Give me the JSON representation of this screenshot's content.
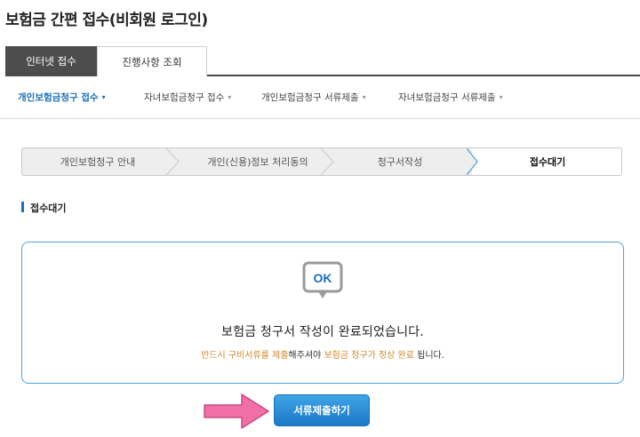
{
  "page": {
    "title": "보험금 간편 접수(비회원 로그인)"
  },
  "top_tabs": [
    {
      "label": "인터넷 접수",
      "active": true
    },
    {
      "label": "진행사항 조회",
      "active": false
    }
  ],
  "sub_nav": [
    {
      "label": "개인보험금청구 접수",
      "caret": "▾",
      "active": true
    },
    {
      "label": "자녀보험금청구 접수",
      "caret": "▾",
      "active": false
    },
    {
      "label": "개인보험금청구 서류제출",
      "caret": "▾",
      "active": false
    },
    {
      "label": "자녀보험금청구 서류제출",
      "caret": "▾",
      "active": false
    }
  ],
  "steps": [
    {
      "label": "개인보험청구 안내",
      "active": false
    },
    {
      "label": "개인(신용)정보 처리동의",
      "active": false
    },
    {
      "label": "청구서작성",
      "active": false
    },
    {
      "label": "접수대기",
      "active": true
    }
  ],
  "section": {
    "title": "접수대기"
  },
  "result": {
    "icon_text": "OK",
    "message": "보험금 청구서 작성이 완료되었습니다.",
    "sub_part1": "반드시 구비서류를 제출",
    "sub_part2": "해주셔야 ",
    "sub_part3": "보험금 청구가 정상 완료",
    "sub_part4": " 됩니다."
  },
  "actions": {
    "submit_label": "서류제출하기"
  },
  "colors": {
    "accent": "#1a6fb6",
    "highlight": "#d48a2a",
    "box_border": "#4aa3d8",
    "arrow": "#f06fa6"
  },
  "icons": {
    "ok": "ok-speech-bubble-icon",
    "arrow": "pink-arrow-icon"
  }
}
